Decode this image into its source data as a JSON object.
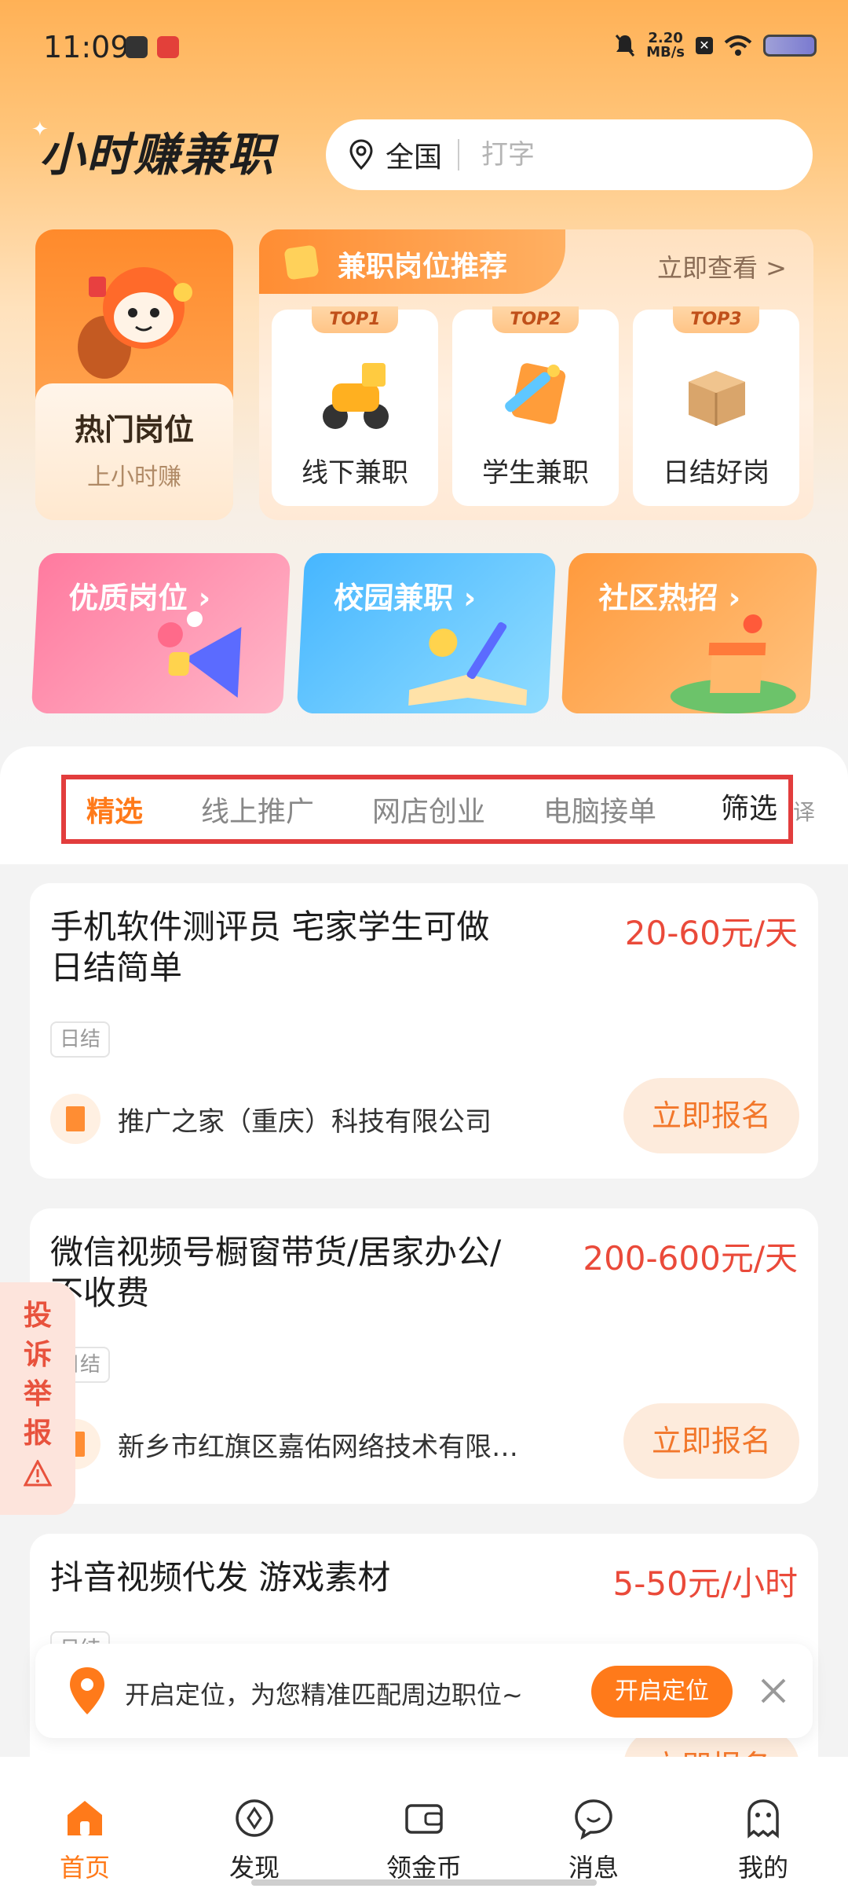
{
  "status_bar": {
    "time": "11:09",
    "speed_value": "2.20",
    "speed_unit": "MB/s"
  },
  "brand": {
    "name": "小时赚兼职"
  },
  "search": {
    "region": "全国",
    "placeholder": "打字"
  },
  "hot_card": {
    "title": "热门岗位",
    "subtitle": "上小时赚"
  },
  "recommend": {
    "title": "兼职岗位推荐",
    "more": "立即查看 >",
    "items": [
      {
        "rank": "TOP1",
        "label": "线下兼职"
      },
      {
        "rank": "TOP2",
        "label": "学生兼职"
      },
      {
        "rank": "TOP3",
        "label": "日结好岗"
      }
    ]
  },
  "categories": [
    {
      "label": "优质岗位 ›"
    },
    {
      "label": "校园兼职 ›"
    },
    {
      "label": "社区热招 ›"
    }
  ],
  "tabs": {
    "items": [
      "精选",
      "线上推广",
      "网店创业",
      "电脑接单"
    ],
    "filter": "筛选",
    "edge_hint": "译"
  },
  "jobs": [
    {
      "title": "手机软件测评员 宅家学生可做日结简单",
      "salary": "20-60元/天",
      "tag": "日结",
      "company": "推广之家（重庆）科技有限公司",
      "apply": "立即报名"
    },
    {
      "title": "微信视频号橱窗带货/居家办公/不收费",
      "salary": "200-600元/天",
      "tag": "日结",
      "company": "新乡市红旗区嘉佑网络技术有限…",
      "apply": "立即报名"
    },
    {
      "title": "抖音视频代发 游戏素材",
      "salary": "5-50元/小时",
      "tag": "日结",
      "company": "",
      "apply": "立即报名"
    }
  ],
  "report": {
    "label": "投诉举报"
  },
  "location_bar": {
    "message": "开启定位，为您精准匹配周边职位~",
    "button": "开启定位"
  },
  "nav": [
    {
      "label": "首页",
      "icon": "home-icon"
    },
    {
      "label": "发现",
      "icon": "compass-icon"
    },
    {
      "label": "领金币",
      "icon": "wallet-icon"
    },
    {
      "label": "消息",
      "icon": "message-icon"
    },
    {
      "label": "我的",
      "icon": "profile-icon"
    }
  ],
  "colors": {
    "accent": "#ff7a1a",
    "salary": "#ea4a3a",
    "highlight_border": "#e23d3d"
  }
}
